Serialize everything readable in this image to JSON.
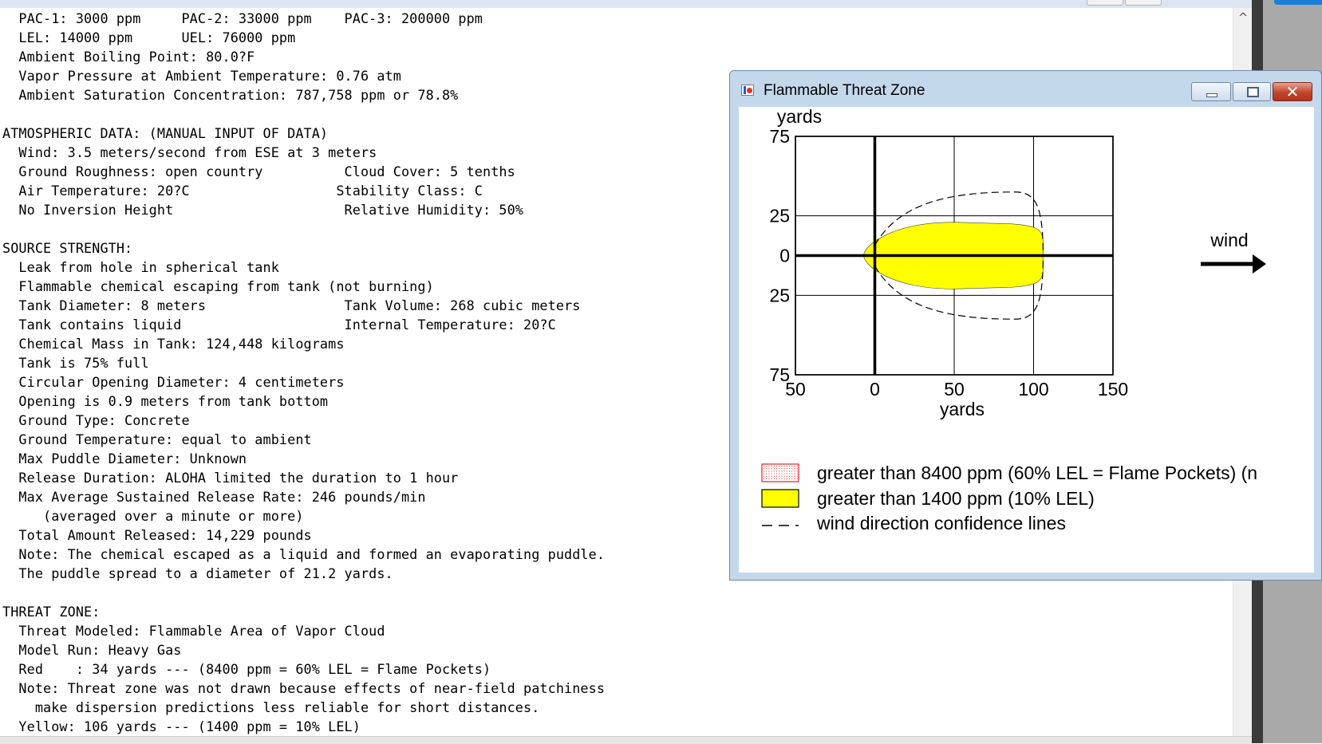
{
  "report": {
    "lines": [
      "  PAC-1: 3000 ppm     PAC-2: 33000 ppm    PAC-3: 200000 ppm",
      "  LEL: 14000 ppm      UEL: 76000 ppm",
      "  Ambient Boiling Point: 80.0?F",
      "  Vapor Pressure at Ambient Temperature: 0.76 atm",
      "  Ambient Saturation Concentration: 787,758 ppm or 78.8%",
      "",
      "ATMOSPHERIC DATA: (MANUAL INPUT OF DATA)",
      "  Wind: 3.5 meters/second from ESE at 3 meters",
      "  Ground Roughness: open country          Cloud Cover: 5 tenths",
      "  Air Temperature: 20?C                  Stability Class: C",
      "  No Inversion Height                     Relative Humidity: 50%",
      "",
      "SOURCE STRENGTH:",
      "  Leak from hole in spherical tank",
      "  Flammable chemical escaping from tank (not burning)",
      "  Tank Diameter: 8 meters                 Tank Volume: 268 cubic meters",
      "  Tank contains liquid                    Internal Temperature: 20?C",
      "  Chemical Mass in Tank: 124,448 kilograms",
      "  Tank is 75% full",
      "  Circular Opening Diameter: 4 centimeters",
      "  Opening is 0.9 meters from tank bottom",
      "  Ground Type: Concrete",
      "  Ground Temperature: equal to ambient",
      "  Max Puddle Diameter: Unknown",
      "  Release Duration: ALOHA limited the duration to 1 hour",
      "  Max Average Sustained Release Rate: 246 pounds/min",
      "     (averaged over a minute or more)",
      "  Total Amount Released: 14,229 pounds",
      "  Note: The chemical escaped as a liquid and formed an evaporating puddle.",
      "  The puddle spread to a diameter of 21.2 yards.",
      "",
      "THREAT ZONE:",
      "  Threat Modeled: Flammable Area of Vapor Cloud",
      "  Model Run: Heavy Gas",
      "  Red    : 34 yards --- (8400 ppm = 60% LEL = Flame Pockets)",
      "  Note: Threat zone was not drawn because effects of near-field patchiness",
      "    make dispersion predictions less reliable for short distances.",
      "  Yellow: 106 yards --- (1400 ppm = 10% LEL)"
    ]
  },
  "popup": {
    "title": "Flammable Threat Zone",
    "close_glyph": "✕",
    "icon": "chart-window-icon"
  },
  "chart_data": {
    "type": "area",
    "title": "",
    "xlabel": "yards",
    "ylabel": "yards",
    "xlim": [
      -50,
      150
    ],
    "ylim": [
      -75,
      75
    ],
    "x_ticks": [
      -50,
      0,
      50,
      100,
      150
    ],
    "x_tick_labels": [
      "50",
      "0",
      "50",
      "100",
      "150"
    ],
    "y_ticks": [
      75,
      25,
      0,
      -25,
      -75
    ],
    "y_tick_labels": [
      "75",
      "25",
      "0",
      "25",
      "75"
    ],
    "grid": true,
    "wind_label": "wind",
    "wind_direction": "right",
    "series": [
      {
        "name": "greater than 1400 ppm (10% LEL)",
        "color": "#ffff00",
        "zone_x_range": [
          -7,
          106
        ],
        "zone_max_half_width": 21
      },
      {
        "name": "wind direction confidence lines",
        "style": "dashed",
        "x_range": [
          0,
          106
        ],
        "max_half_width": 40
      }
    ],
    "legend": [
      {
        "swatch": "red-dotted",
        "label": "greater than 8400 ppm (60% LEL = Flame Pockets) (n"
      },
      {
        "swatch": "yellow",
        "label": "greater than 1400 ppm (10% LEL)"
      },
      {
        "swatch": "dashed-line",
        "label": "wind direction confidence lines"
      }
    ],
    "legend_placement": "bottom"
  },
  "colors": {
    "yellow_zone": "#ffff00",
    "red_zone": "#e02020",
    "title_bar": "#c4d8ec"
  }
}
